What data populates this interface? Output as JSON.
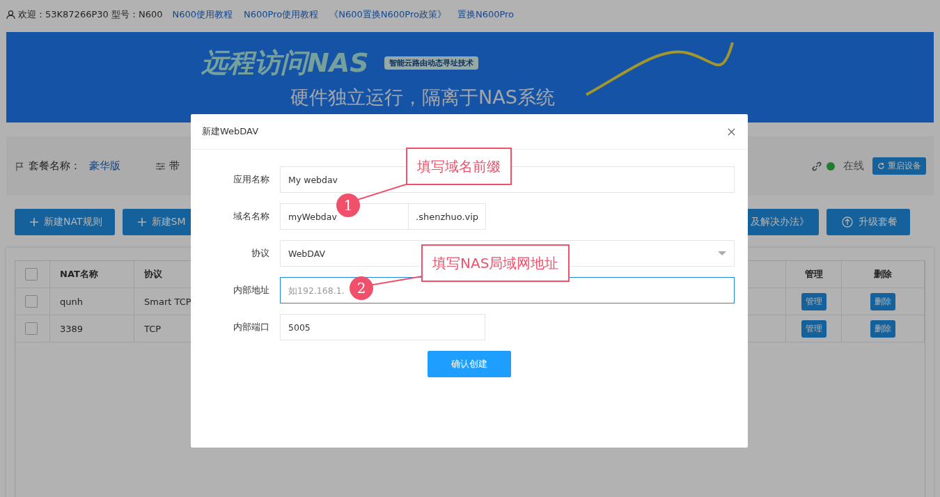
{
  "top_bar": {
    "welcome": "欢迎：53K87266P30 型号：N600",
    "links": [
      "N600使用教程",
      "N600Pro使用教程",
      "《N600置换N600Pro政策》",
      "置换N600Pro"
    ]
  },
  "banner": {
    "title": "远程访问NAS",
    "tag": "智能云路由动态寻址技术",
    "subtitle": "硬件独立运行，隔离于NAS系统"
  },
  "plan_panel": {
    "plan_label": "套餐名称：",
    "plan_name": "豪华版",
    "bandwidth_label": "带",
    "online": true,
    "status": "在线",
    "restart_button": "重启设备"
  },
  "actions": [
    {
      "label": "新建NAT规则",
      "kind": "plus"
    },
    {
      "label": "新建SM",
      "kind": "plus"
    },
    {
      "label": "及解决办法》",
      "kind": "plain"
    },
    {
      "label": "升级套餐",
      "kind": "upgrade"
    }
  ],
  "table": {
    "all_checked": false,
    "columns": [
      "NAT名称",
      "协议",
      "管理",
      "删除"
    ],
    "rows": [
      {
        "checked": false,
        "name": "qunh",
        "protocol": "Smart TCP",
        "manage": "管理",
        "delete": "删除"
      },
      {
        "checked": false,
        "name": "3389",
        "protocol": "TCP",
        "manage": "管理",
        "delete": "删除"
      }
    ]
  },
  "dialog": {
    "title": "新建WebDAV",
    "fields": [
      {
        "label": "应用名称",
        "kind": "text",
        "value": "My webdav",
        "focused": false
      },
      {
        "label": "域名名称",
        "kind": "suffix",
        "value": "myWebdav",
        "suffix": ".shenzhuo.vip",
        "focused": false
      },
      {
        "label": "协议",
        "kind": "select",
        "value": "WebDAV",
        "focused": false
      },
      {
        "label": "内部地址",
        "kind": "text",
        "placeholder": "如192.168.1.",
        "focused": true
      },
      {
        "label": "内部端口",
        "kind": "short",
        "value": "5005",
        "focused": false
      }
    ],
    "submit": "确认创建"
  },
  "annotations": [
    {
      "number": "1",
      "text": "填写域名前缀"
    },
    {
      "number": "2",
      "text": "填写NAS局域网地址"
    }
  ]
}
